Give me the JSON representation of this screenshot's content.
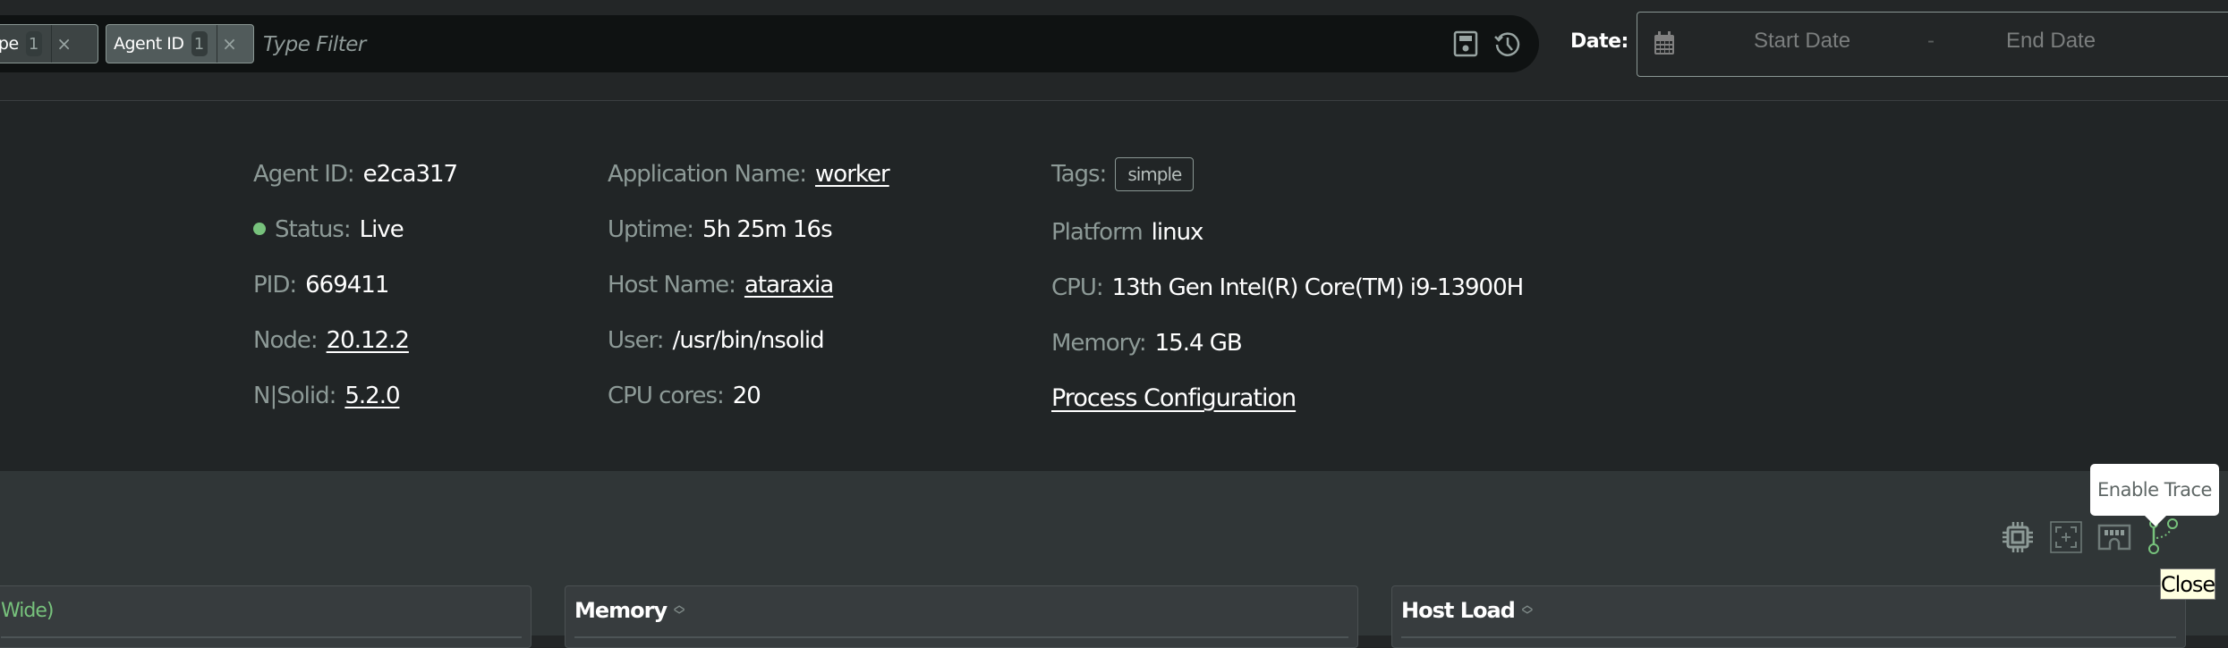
{
  "filter_bar": {
    "chips": [
      {
        "label": "Type",
        "count": "1",
        "remove": "×"
      },
      {
        "label": "Agent ID",
        "count": "1",
        "remove": "×"
      }
    ],
    "input_placeholder": "Type Filter",
    "input_value": "",
    "save_icon": "save-filter-icon",
    "history_icon": "history-icon"
  },
  "date_filter": {
    "label": "Date:",
    "start_placeholder": "Start Date",
    "separator": "-",
    "end_placeholder": "End Date",
    "calendar_icon": "calendar-icon"
  },
  "process_info": {
    "col1": [
      {
        "key": "Agent ID:",
        "value": "e2ca317"
      },
      {
        "key": "Status:",
        "value": "Live",
        "status_color": "#77c27c"
      },
      {
        "key": "PID:",
        "value": "669411"
      },
      {
        "key": "Node:",
        "value": "20.12.2"
      },
      {
        "key": "N|Solid:",
        "value": "5.2.0"
      }
    ],
    "col2": [
      {
        "key": "Application Name:",
        "value": "worker"
      },
      {
        "key": "Uptime:",
        "value": "5h 25m 16s"
      },
      {
        "key": "Host Name:",
        "value": "ataraxia"
      },
      {
        "key": "User:",
        "value": "/usr/bin/nsolid"
      },
      {
        "key": "CPU cores:",
        "value": "20"
      }
    ],
    "col3": [
      {
        "key": "Tags:",
        "value": "simple"
      },
      {
        "key": "Platform",
        "value": "linux"
      },
      {
        "key": "CPU:",
        "value": "13th Gen Intel(R) Core(TM) i9-13900H"
      },
      {
        "key": "Memory:",
        "value": "15.4 GB"
      }
    ],
    "process_configuration_link": "Process Configuration"
  },
  "actions": {
    "cpu_profile_icon": "cpu-icon",
    "heap_snapshot_icon": "snapshot-icon",
    "heap_sampling_icon": "memory-icon",
    "trace_icon": "trace-icon",
    "trace_tooltip": "Enable Trace",
    "close_tooltip": "Close",
    "accent_color": "#77c27c"
  },
  "panels": [
    {
      "title_fragment": "Wide)"
    },
    {
      "title": "Memory"
    },
    {
      "title": "Host Load"
    }
  ]
}
